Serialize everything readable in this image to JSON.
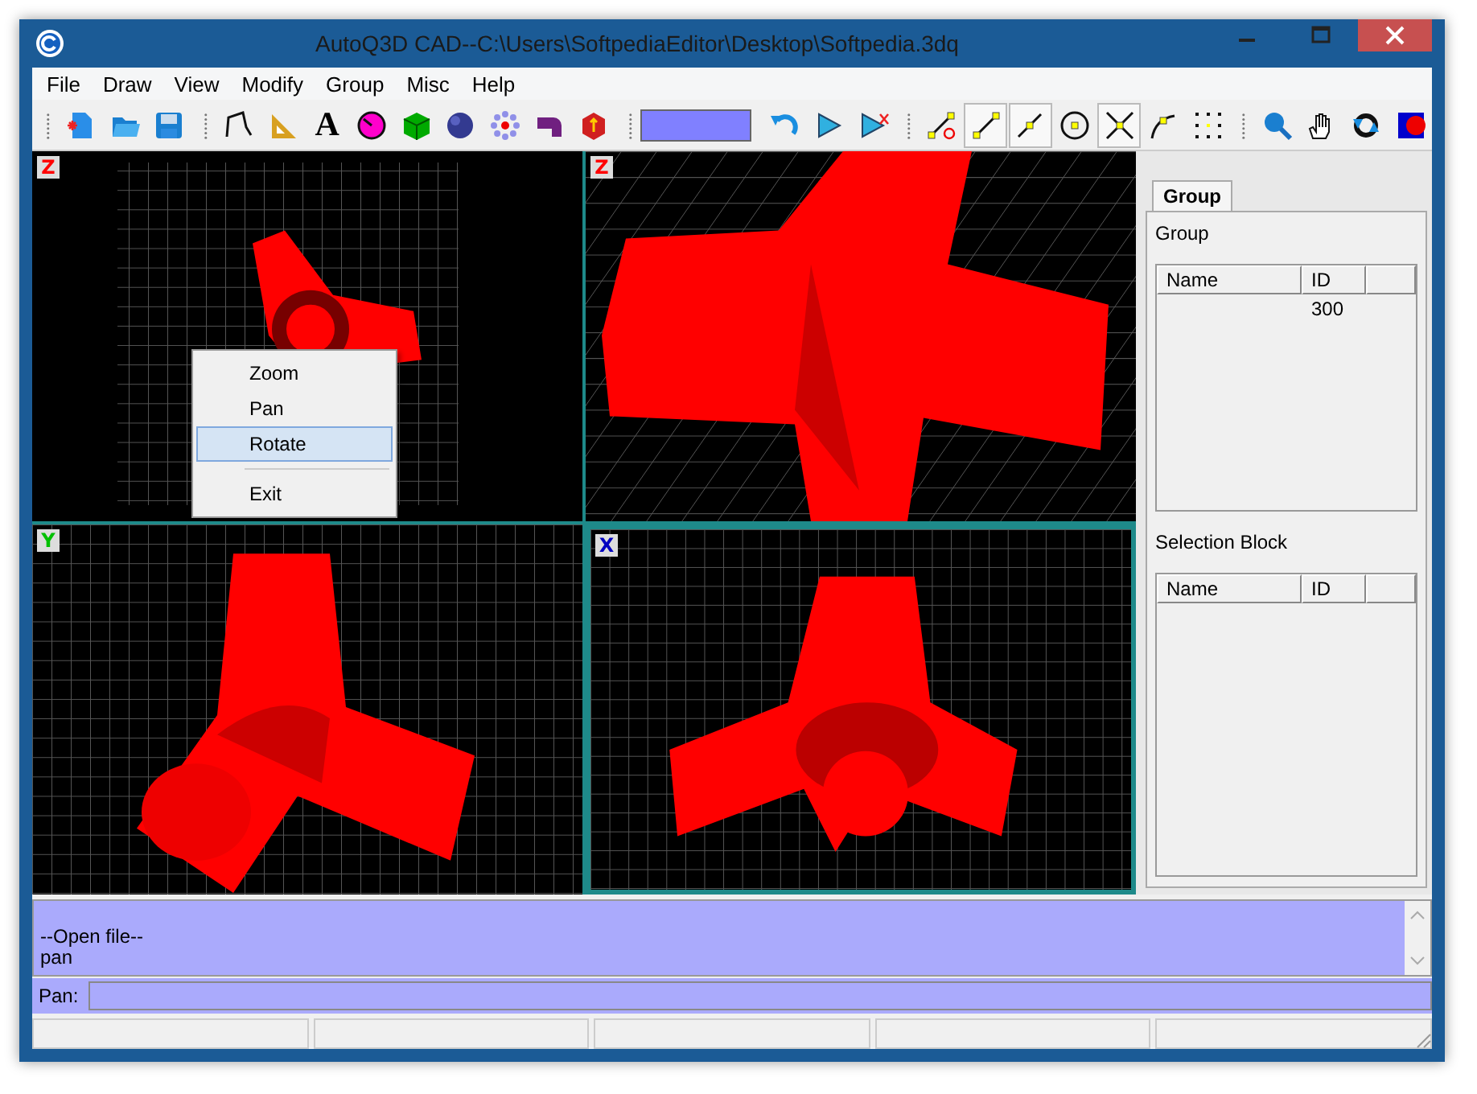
{
  "window": {
    "title": "AutoQ3D CAD--C:\\Users\\SoftpediaEditor\\Desktop\\Softpedia.3dq"
  },
  "menu": [
    "File",
    "Draw",
    "View",
    "Modify",
    "Group",
    "Misc",
    "Help"
  ],
  "toolbars": [
    {
      "items": [
        {
          "kind": "new",
          "pressed": false
        },
        {
          "kind": "open",
          "pressed": false
        },
        {
          "kind": "save",
          "pressed": false
        }
      ]
    },
    {
      "items": [
        {
          "kind": "polyline",
          "pressed": false
        },
        {
          "kind": "set-square",
          "pressed": false
        },
        {
          "kind": "text",
          "label": "A",
          "pressed": false
        },
        {
          "kind": "dial",
          "pressed": false
        },
        {
          "kind": "cube",
          "pressed": false
        },
        {
          "kind": "sphere",
          "pressed": false
        },
        {
          "kind": "ring",
          "pressed": false
        },
        {
          "kind": "pipe",
          "pressed": false
        },
        {
          "kind": "box",
          "pressed": false
        }
      ]
    },
    {
      "items": [
        {
          "kind": "swatch",
          "color": "#8080ff",
          "pressed": false
        },
        {
          "kind": "undo",
          "pressed": false
        },
        {
          "kind": "cone",
          "pressed": false
        },
        {
          "kind": "cone-cut",
          "pressed": false
        }
      ]
    },
    {
      "items": [
        {
          "kind": "snap-end",
          "pressed": false
        },
        {
          "kind": "line",
          "pressed": true
        },
        {
          "kind": "mid",
          "pressed": true
        },
        {
          "kind": "center",
          "pressed": false
        },
        {
          "kind": "cross",
          "pressed": true
        },
        {
          "kind": "arc",
          "pressed": false
        },
        {
          "kind": "grid",
          "pressed": false
        }
      ]
    },
    {
      "items": [
        {
          "kind": "zoom",
          "pressed": false
        },
        {
          "kind": "hand",
          "pressed": false
        },
        {
          "kind": "rotate",
          "pressed": false
        },
        {
          "kind": "render",
          "pressed": false
        }
      ]
    }
  ],
  "viewports": [
    {
      "kind": "top",
      "axis": "Z",
      "color": "#ff0000",
      "active": false
    },
    {
      "kind": "perspective",
      "axis": "Z",
      "color": "#ff0000",
      "active": false
    },
    {
      "kind": "front",
      "axis": "Y",
      "color": "#00c000",
      "active": false
    },
    {
      "kind": "side",
      "axis": "X",
      "color": "#0000c0",
      "active": true
    }
  ],
  "context_menu": {
    "items": [
      {
        "label": "Zoom",
        "selected": false,
        "divider_above": false
      },
      {
        "label": "Pan",
        "selected": false,
        "divider_above": false
      },
      {
        "label": "Rotate",
        "selected": true,
        "divider_above": false
      },
      {
        "label": "Exit",
        "selected": false,
        "divider_above": true
      }
    ]
  },
  "panel": {
    "tabs": [
      {
        "label": "Group",
        "selected": true
      }
    ],
    "lists": [
      {
        "title": "Group",
        "columns": [
          "Name",
          "ID"
        ],
        "rows": [
          {
            "id": "300"
          }
        ]
      },
      {
        "title": "Selection Block",
        "columns": [
          "Name",
          "ID"
        ]
      }
    ]
  },
  "command_log": [
    "--Open file--",
    "pan"
  ],
  "prompt": {
    "label": "Pan:"
  }
}
